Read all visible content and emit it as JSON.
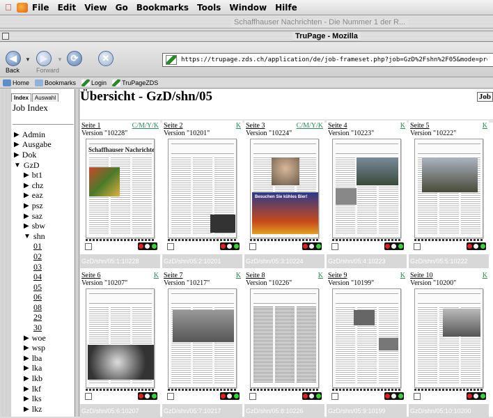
{
  "menubar": {
    "items": [
      "File",
      "Edit",
      "View",
      "Go",
      "Bookmarks",
      "Tools",
      "Window",
      "Hilfe"
    ]
  },
  "background_window": {
    "title": "Schaffhauser Nachrichten - Die Nummer 1 der R..."
  },
  "window": {
    "title": "TruPage - Mozilla"
  },
  "toolbar": {
    "back_label": "Back",
    "forward_label": "Forward",
    "url": "https://trupage.zds.ch/application/de/job-frameset.php?job=GzD%2Fshn%2F05&mode=preview"
  },
  "personal_toolbar": {
    "items": [
      "Home",
      "Bookmarks",
      "Login",
      "TruPageZDS"
    ]
  },
  "sidebar": {
    "tabs": [
      "Index",
      "Auswahl"
    ],
    "heading": "Job Index",
    "tree": [
      {
        "label": "Admin",
        "level": 0,
        "arrow": "▶"
      },
      {
        "label": "Ausgabe",
        "level": 0,
        "arrow": "▶"
      },
      {
        "label": "Dok",
        "level": 0,
        "arrow": "▶"
      },
      {
        "label": "GzD",
        "level": 0,
        "arrow": "▼"
      },
      {
        "label": "bt1",
        "level": 1,
        "arrow": "▶"
      },
      {
        "label": "chz",
        "level": 1,
        "arrow": "▶"
      },
      {
        "label": "eaz",
        "level": 1,
        "arrow": "▶"
      },
      {
        "label": "psz",
        "level": 1,
        "arrow": "▶"
      },
      {
        "label": "saz",
        "level": 1,
        "arrow": "▶"
      },
      {
        "label": "sbw",
        "level": 1,
        "arrow": "▶"
      },
      {
        "label": "shn",
        "level": 1,
        "arrow": "▼"
      },
      {
        "label": "01",
        "level": 2
      },
      {
        "label": "02",
        "level": 2
      },
      {
        "label": "03",
        "level": 2
      },
      {
        "label": "04",
        "level": 2
      },
      {
        "label": "05",
        "level": 2
      },
      {
        "label": "06",
        "level": 2
      },
      {
        "label": "08",
        "level": 2
      },
      {
        "label": "29",
        "level": 2
      },
      {
        "label": "30",
        "level": 2
      },
      {
        "label": "woe",
        "level": 1,
        "arrow": "▶"
      },
      {
        "label": "wsp",
        "level": 1,
        "arrow": "▶"
      },
      {
        "label": "lba",
        "level": 1,
        "arrow": "▶"
      },
      {
        "label": "lka",
        "level": 1,
        "arrow": "▶"
      },
      {
        "label": "lkb",
        "level": 1,
        "arrow": "▶"
      },
      {
        "label": "lkf",
        "level": 1,
        "arrow": "▶"
      },
      {
        "label": "lks",
        "level": 1,
        "arrow": "▶"
      },
      {
        "label": "lkz",
        "level": 1,
        "arrow": "▶"
      }
    ]
  },
  "main": {
    "heading": "Übersicht - GzD/shn/05",
    "job_button": "Job",
    "pages": [
      {
        "seite": "Seite 1",
        "sep": "C/M/Y/K",
        "version": "Version \"10228\"",
        "footer": "GzD/shn/05:1:10228",
        "thumb": "front",
        "headline": "Schaffhauser Nachrichten"
      },
      {
        "seite": "Seite 2",
        "sep": "K",
        "version": "Version \"10201\"",
        "footer": "GzD/shn/05:2:10201",
        "thumb": "text-ad"
      },
      {
        "seite": "Seite 3",
        "sep": "C/M/Y/K",
        "version": "Version \"10224\"",
        "footer": "GzD/shn/05:3:10224",
        "thumb": "portrait-ad",
        "ad_text": "Besuchen Sie kühles Bier!"
      },
      {
        "seite": "Seite 4",
        "sep": "K",
        "version": "Version \"10223\"",
        "footer": "GzD/shn/05:4:10223",
        "thumb": "photo"
      },
      {
        "seite": "Seite 5",
        "sep": "K",
        "version": "Version \"10222\"",
        "footer": "GzD/shn/05:5:10222",
        "thumb": "photo2"
      },
      {
        "seite": "Seite 6",
        "sep": "K",
        "version": "Version \"10207\"",
        "footer": "GzD/shn/05:6:10207",
        "thumb": "face"
      },
      {
        "seite": "Seite 7",
        "sep": "K",
        "version": "Version \"10217\"",
        "footer": "GzD/shn/05:7:10217",
        "thumb": "photo3"
      },
      {
        "seite": "Seite 8",
        "sep": "K",
        "version": "Version \"10226\"",
        "footer": "GzD/shn/05:8:10226",
        "thumb": "tables"
      },
      {
        "seite": "Seite 9",
        "sep": "K",
        "version": "Version \"10199\"",
        "footer": "GzD/shn/05:9:10199",
        "thumb": "listings"
      },
      {
        "seite": "Seite 10",
        "sep": "K",
        "version": "Version \"10200\"",
        "footer": "GzD/shn/05:10:10200",
        "thumb": "people"
      }
    ]
  },
  "colors": {
    "sep_link": "#2e8b57",
    "led_red": "#e02020",
    "led_green": "#3ad23a",
    "led_white": "#f0f0f0"
  }
}
